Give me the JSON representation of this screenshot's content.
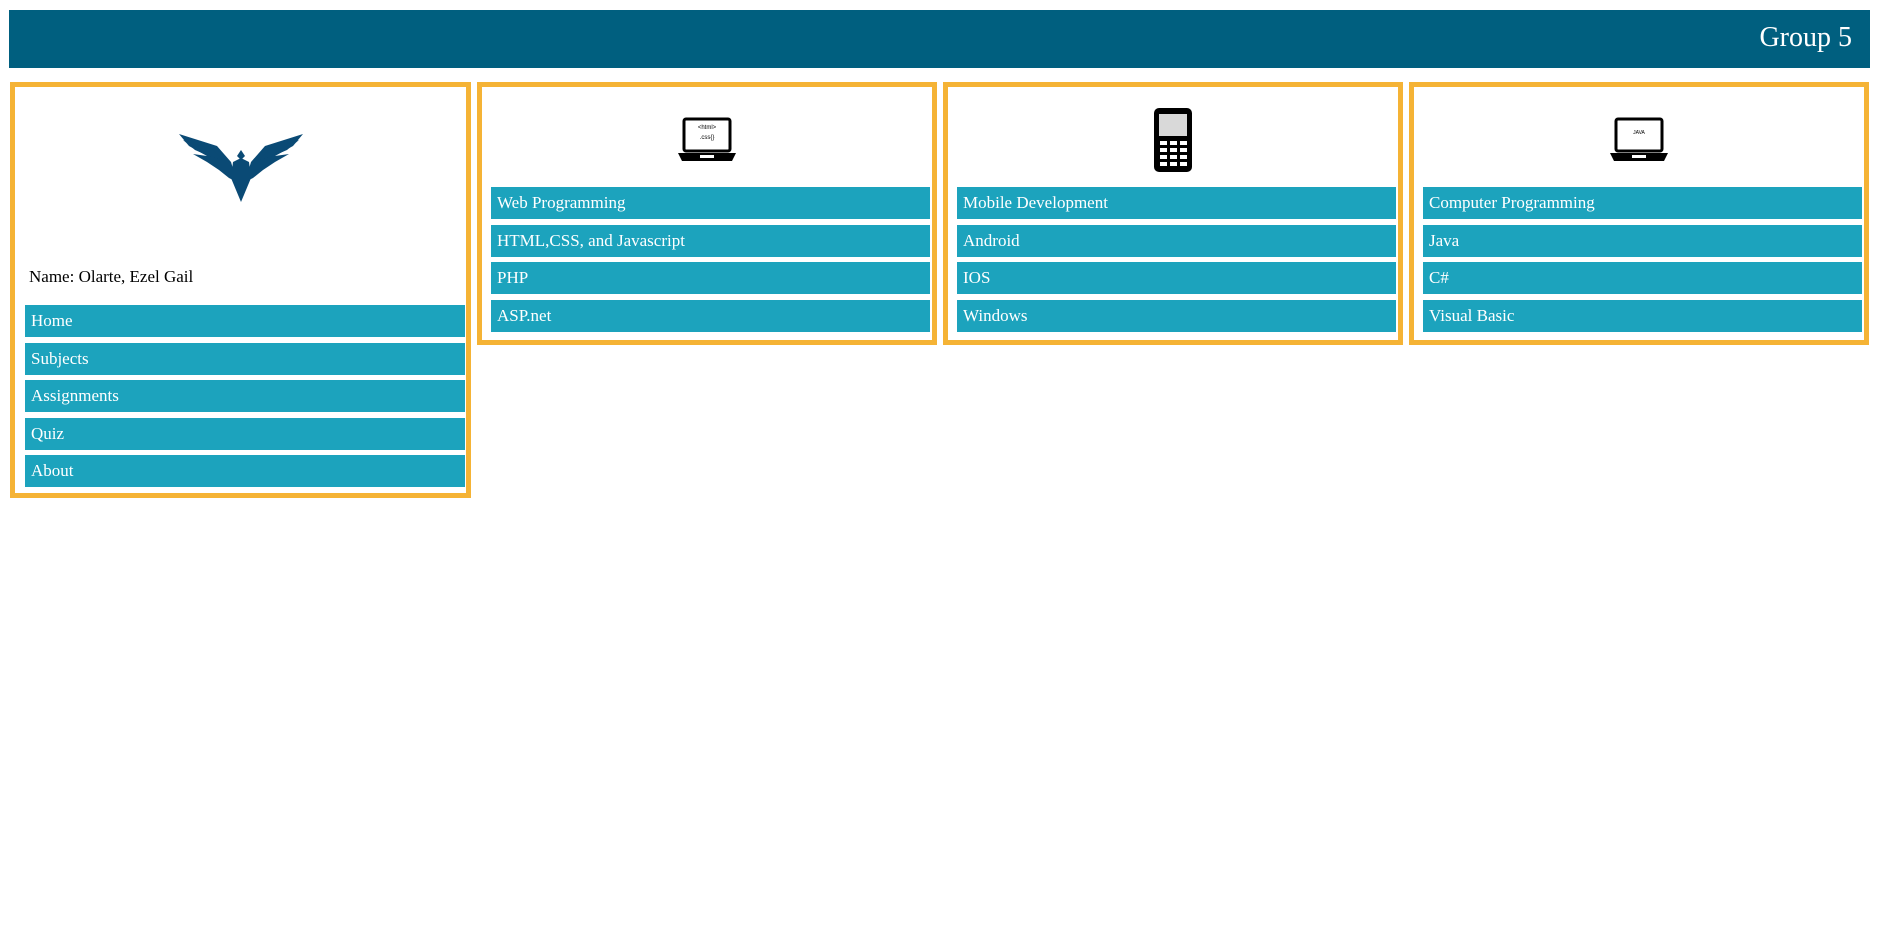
{
  "header": {
    "title": "Group 5",
    "color": "#005f7f"
  },
  "sidebar": {
    "logo_icon": "eagle-logo",
    "name_line": "Name: Olarte, Ezel Gail",
    "items": [
      {
        "label": "Home"
      },
      {
        "label": "Subjects"
      },
      {
        "label": "Assignments"
      },
      {
        "label": "Quiz"
      },
      {
        "label": "About"
      }
    ]
  },
  "columns": [
    {
      "icon": "laptop-html-icon",
      "screen_text": [
        "<html>",
        ".css{}"
      ],
      "items": [
        {
          "label": "Web Programming"
        },
        {
          "label": "HTML,CSS, and Javascript"
        },
        {
          "label": "PHP"
        },
        {
          "label": "ASP.net"
        }
      ]
    },
    {
      "icon": "mobile-phone-icon",
      "items": [
        {
          "label": "Mobile Development"
        },
        {
          "label": "Android"
        },
        {
          "label": "IOS"
        },
        {
          "label": "Windows"
        }
      ]
    },
    {
      "icon": "laptop-java-icon",
      "screen_text": [
        "JAVA"
      ],
      "items": [
        {
          "label": "Computer Programming"
        },
        {
          "label": "Java"
        },
        {
          "label": "C#"
        },
        {
          "label": "Visual Basic"
        }
      ]
    }
  ],
  "colors": {
    "panel_border": "#f5b335",
    "item_background": "#1ca3bd",
    "logo": "#0a4a75"
  }
}
